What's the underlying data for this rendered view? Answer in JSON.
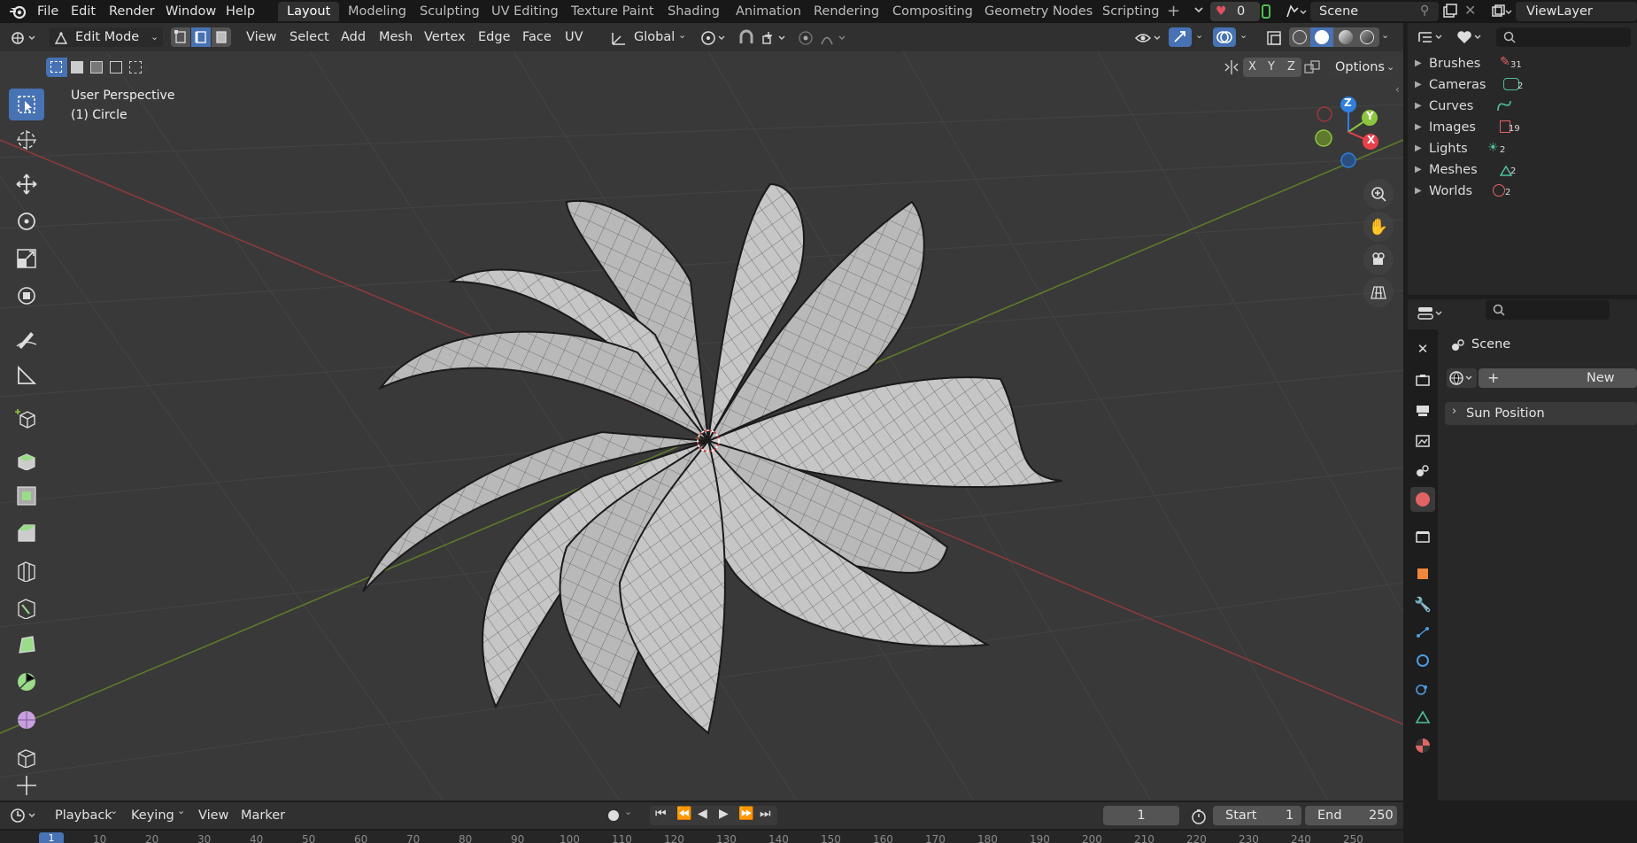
{
  "menubar": {
    "items": [
      "File",
      "Edit",
      "Render",
      "Window",
      "Help"
    ],
    "workspaces": [
      "Layout",
      "Modeling",
      "Sculpting",
      "UV Editing",
      "Texture Paint",
      "Shading",
      "Animation",
      "Rendering",
      "Compositing",
      "Geometry Nodes",
      "Scripting"
    ],
    "active_workspace": "Layout",
    "add_workspace": "+",
    "heart_count": "0",
    "scene_name": "Scene",
    "view_layer": "ViewLayer"
  },
  "viewport_header": {
    "mode": "Edit Mode",
    "menus": [
      "View",
      "Select",
      "Add",
      "Mesh",
      "Vertex",
      "Edge",
      "Face",
      "UV"
    ],
    "transform_orientation": "Global",
    "mirror_axes": [
      "X",
      "Y",
      "Z"
    ],
    "options_label": "Options"
  },
  "viewport": {
    "view_name": "User Perspective",
    "object_info": "(1) Circle",
    "gizmo": {
      "z": "Z",
      "y": "Y",
      "x": "X"
    }
  },
  "outliner": {
    "items": [
      {
        "label": "Brushes",
        "count": "31",
        "icon": "brush-icon",
        "color": "#e06464"
      },
      {
        "label": "Cameras",
        "count": "2",
        "icon": "camera-data-icon",
        "color": "#4fbfa0"
      },
      {
        "label": "Curves",
        "count": "",
        "icon": "curve-icon",
        "color": "#4fbfa0"
      },
      {
        "label": "Images",
        "count": "19",
        "icon": "image-icon",
        "color": "#e06464"
      },
      {
        "label": "Lights",
        "count": "2",
        "icon": "light-icon",
        "color": "#4fbfa0"
      },
      {
        "label": "Meshes",
        "count": "2",
        "icon": "mesh-icon",
        "color": "#4fbfa0"
      },
      {
        "label": "Worlds",
        "count": "2",
        "icon": "world-icon",
        "color": "#e06464"
      }
    ]
  },
  "properties": {
    "context_label": "Scene",
    "world_new_label": "New",
    "world_new_plus": "+",
    "panels": [
      "Sun Position"
    ]
  },
  "timeline": {
    "menus": [
      "Playback",
      "Keying",
      "View",
      "Marker"
    ],
    "current_frame": "1",
    "start_label": "Start",
    "start_value": "1",
    "end_label": "End",
    "end_value": "250",
    "ruler_ticks": [
      "1",
      "10",
      "20",
      "30",
      "40",
      "50",
      "60",
      "70",
      "80",
      "90",
      "100",
      "110",
      "120",
      "130",
      "140",
      "150",
      "160",
      "170",
      "180",
      "190",
      "200",
      "210",
      "220",
      "230",
      "240",
      "250"
    ]
  },
  "colors": {
    "accent": "#4772b3",
    "axis_x": "#e8404a",
    "axis_y": "#8cc63f",
    "axis_z": "#2f7fe0",
    "frame_highlight": "#4772b3"
  }
}
